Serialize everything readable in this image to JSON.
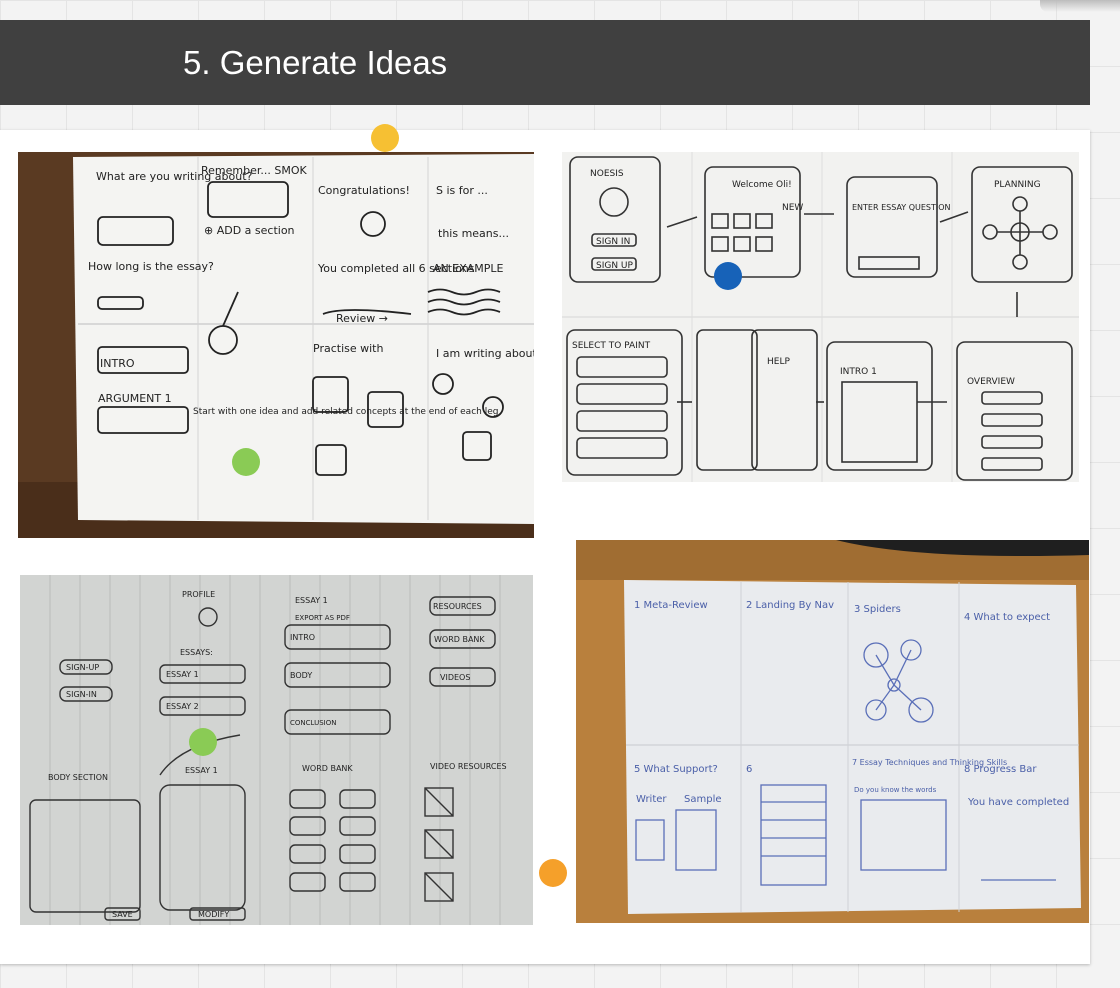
{
  "header": {
    "title": "5. Generate Ideas"
  },
  "colors": {
    "header_bg": "#404040",
    "marker_yellow": "#f6c033",
    "marker_green": "#8acb55",
    "marker_blue": "#1762b8",
    "marker_orange": "#f5a02a"
  },
  "photos": {
    "top_left": {
      "q1": "What are you writing about?",
      "q2": "Remember... SMOK",
      "add": "⊕ ADD a section",
      "congrats": "Congratulations!",
      "s_is_for": "S is for ...",
      "means": "this means...",
      "how_long": "How long is the essay?",
      "completed": "You completed all 6 sections",
      "example": "AN EXAMPLE",
      "review": "Review →",
      "intro": "INTRO",
      "arg": "ARGUMENT 1",
      "start": "Start with one idea and add related concepts at the end of each leg",
      "practise": "Practise with",
      "writing": "I am writing about"
    },
    "top_right": {
      "app": "NOESIS",
      "sign_in": "SIGN IN",
      "sign_up": "SIGN UP",
      "welcome": "Welcome Oli!",
      "new": "NEW",
      "enter": "ENTER ESSAY QUESTION",
      "planning": "PLANNING",
      "select": "SELECT TO PAINT",
      "help": "HELP",
      "intro": "INTRO 1",
      "overview": "OVERVIEW"
    },
    "bottom_left": {
      "profile": "PROFILE",
      "essay1": "ESSAY 1",
      "resources": "RESOURCES",
      "export": "EXPORT AS PDF",
      "word_bank": "WORD BANK",
      "videos": "VIDEOS",
      "essays": "ESSAYS:",
      "sign_up": "SIGN-UP",
      "sign_in": "SIGN-IN",
      "essay_a": "ESSAY 1",
      "essay_b": "ESSAY 2",
      "intro": "INTRO",
      "body": "BODY",
      "conclusion": "CONCLUSION",
      "body_section": "BODY SECTION",
      "essay_head": "ESSAY 1",
      "word_bank_head": "WORD BANK",
      "video_res": "VIDEO RESOURCES",
      "save": "SAVE",
      "modify": "MODIFY"
    },
    "bottom_right": {
      "p1": "1 Meta-Review",
      "p2": "2 Landing By Nav",
      "p3": "3 Spiders",
      "p4": "4 What to expect",
      "p5": "5 What Support?",
      "p6": "6",
      "p7": "7 Essay Techniques and Thinking Skills",
      "p8": "8 Progress Bar",
      "writer": "Writer",
      "sample": "Sample",
      "know": "Do you know the words",
      "completed": "You have completed"
    }
  }
}
